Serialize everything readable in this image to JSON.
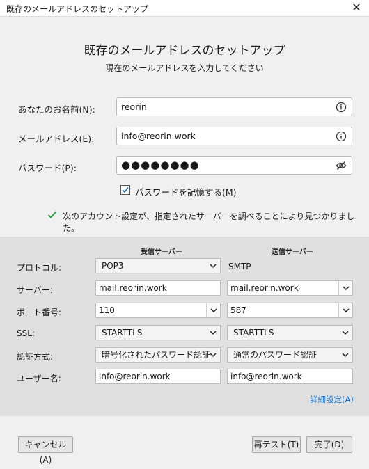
{
  "window": {
    "title": "既存のメールアドレスのセットアップ",
    "close_glyph": "✕"
  },
  "header": {
    "title": "既存のメールアドレスのセットアップ",
    "subtitle": "現在のメールアドレスを入力してください"
  },
  "form": {
    "name_label": "あなたのお名前(N):",
    "name_value": "reorin",
    "email_label": "メールアドレス(E):",
    "email_value": "info@reorin.work",
    "password_label": "パスワード(P):",
    "password_value": "●●●●●●●●",
    "remember_label": "パスワードを記憶する(M)",
    "remember_checked": true
  },
  "status": {
    "message": "次のアカウント設定が、指定されたサーバーを調べることにより見つかりました。",
    "color": "#2e9e3e"
  },
  "settings": {
    "incoming_header": "受信サーバー",
    "outgoing_header": "送信サーバー",
    "protocol_label": "プロトコル:",
    "server_label": "サーバー:",
    "port_label": "ポート番号:",
    "ssl_label": "SSL:",
    "auth_label": "認証方式:",
    "username_label": "ユーザー名:",
    "incoming": {
      "protocol": "POP3",
      "server": "mail.reorin.work",
      "port": "110",
      "ssl": "STARTTLS",
      "auth": "暗号化されたパスワード認証",
      "username": "info@reorin.work"
    },
    "outgoing": {
      "protocol": "SMTP",
      "server": "mail.reorin.work",
      "port": "587",
      "ssl": "STARTTLS",
      "auth": "通常のパスワード認証",
      "username": "info@reorin.work"
    },
    "advanced_link": "詳細設定(A)"
  },
  "buttons": {
    "cancel": "キャンセル(A)",
    "retest": "再テスト(T)",
    "done": "完了(D)"
  },
  "icons": {
    "info": "info-icon",
    "eye_slash": "eye-slash-icon",
    "check": "checkmark-icon",
    "dropdown": "chevron-down-icon",
    "close": "close-icon"
  }
}
